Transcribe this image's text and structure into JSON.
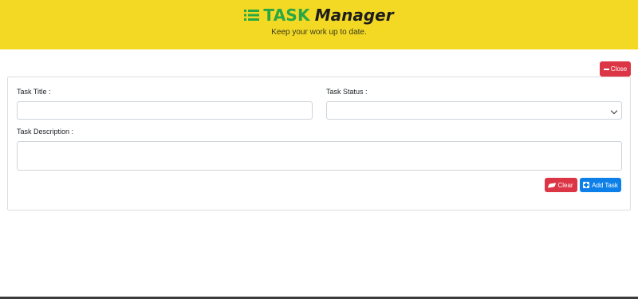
{
  "header": {
    "brand_task": "TASK",
    "brand_manager": "Manager",
    "tagline": "Keep your work up to date."
  },
  "close_button": {
    "label": "Close"
  },
  "form": {
    "title_label": "Task Title :",
    "title_value": "",
    "status_label": "Task Status :",
    "status_selected": "",
    "description_label": "Task Description :",
    "description_value": ""
  },
  "actions": {
    "clear_label": "Clear",
    "add_label": "Add Task"
  },
  "colors": {
    "header_bg": "#f3d924",
    "brand_green": "#28a745",
    "danger": "#dc3545",
    "primary": "#0d7fe8"
  },
  "icons": {
    "brand": "list-icon",
    "close": "minus-icon",
    "clear": "eraser-icon",
    "add": "plus-square-icon"
  }
}
